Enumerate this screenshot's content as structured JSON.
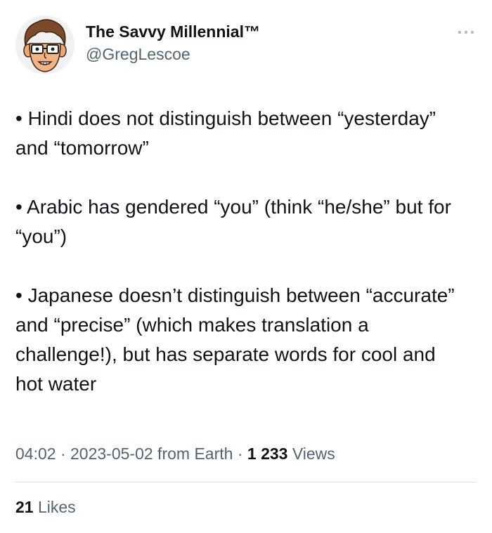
{
  "author": {
    "display_name": "The Savvy Millennial™",
    "handle": "@GregLescoe",
    "avatar_icon": "cartoon-avatar-icon"
  },
  "more_icon": "more-horizontal-icon",
  "tweet": {
    "paragraphs": [
      "• Hindi does not distinguish between “yesterday” and “tomorrow”",
      "• Arabic has gendered “you” (think “he/she” but for “you”)",
      "• Japanese doesn’t distinguish between “accurate” and “precise” (which makes translation a challenge!), but has separate words for cool and hot water"
    ]
  },
  "meta": {
    "time": "04:02",
    "separator": " · ",
    "date": "2023-05-02",
    "source": " from Earth",
    "views_count": "1 233",
    "views_label": " Views"
  },
  "stats": {
    "likes_count": "21",
    "likes_label": " Likes"
  },
  "colors": {
    "text_primary": "#0f1419",
    "text_secondary": "#536471",
    "divider": "#e1e4e7"
  }
}
